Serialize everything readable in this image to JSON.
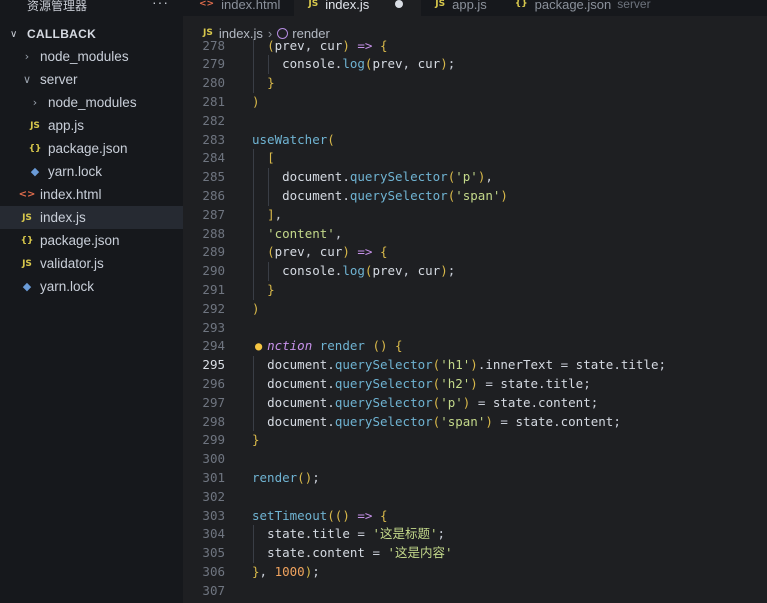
{
  "sidebar": {
    "title": "资源管理器",
    "more": "···",
    "section": "CALLBACK",
    "items": [
      {
        "label": "node_modules",
        "icon": "chevron-right",
        "level": 1
      },
      {
        "label": "server",
        "icon": "chevron-down",
        "level": 1
      },
      {
        "label": "node_modules",
        "icon": "chevron-right",
        "level": 2
      },
      {
        "label": "app.js",
        "icon": "js",
        "level": 2
      },
      {
        "label": "package.json",
        "icon": "json",
        "level": 2
      },
      {
        "label": "yarn.lock",
        "icon": "yarn",
        "level": 2
      },
      {
        "label": "index.html",
        "icon": "html",
        "level": 1
      },
      {
        "label": "index.js",
        "icon": "js",
        "level": 1,
        "active": true
      },
      {
        "label": "package.json",
        "icon": "json",
        "level": 1
      },
      {
        "label": "validator.js",
        "icon": "js",
        "level": 1
      },
      {
        "label": "yarn.lock",
        "icon": "yarn",
        "level": 1
      }
    ]
  },
  "tabs": [
    {
      "label": "index.html",
      "icon": "html"
    },
    {
      "label": "index.js",
      "icon": "js",
      "active": true,
      "modified": true
    },
    {
      "label": "app.js",
      "icon": "js"
    },
    {
      "label": "package.json",
      "icon": "json",
      "sub": "server"
    }
  ],
  "breadcrumb": {
    "file": "index.js",
    "symbol": "render",
    "file_icon": "JS"
  },
  "icon_text": {
    "js": "JS",
    "json": "{}",
    "html": "<>"
  },
  "editor": {
    "current_line": 295,
    "lines": [
      {
        "n": 278,
        "text": "  (prev, cur) => {"
      },
      {
        "n": 279,
        "text": "    console.log(prev, cur);"
      },
      {
        "n": 280,
        "text": "  }"
      },
      {
        "n": 281,
        "text": ")"
      },
      {
        "n": 282,
        "text": ""
      },
      {
        "n": 283,
        "text": "useWatcher("
      },
      {
        "n": 284,
        "text": "  ["
      },
      {
        "n": 285,
        "text": "    document.querySelector('p'),"
      },
      {
        "n": 286,
        "text": "    document.querySelector('span')"
      },
      {
        "n": 287,
        "text": "  ],"
      },
      {
        "n": 288,
        "text": "  'content',"
      },
      {
        "n": 289,
        "text": "  (prev, cur) => {"
      },
      {
        "n": 290,
        "text": "    console.log(prev, cur);"
      },
      {
        "n": 291,
        "text": "  }"
      },
      {
        "n": 292,
        "text": ")"
      },
      {
        "n": 293,
        "text": ""
      },
      {
        "n": 294,
        "text": "  nction render () {"
      },
      {
        "n": 295,
        "text": "  document.querySelector('h1').innerText = state.title;"
      },
      {
        "n": 296,
        "text": "  document.querySelector('h2') = state.title;"
      },
      {
        "n": 297,
        "text": "  document.querySelector('p') = state.content;"
      },
      {
        "n": 298,
        "text": "  document.querySelector('span') = state.content;"
      },
      {
        "n": 299,
        "text": "}"
      },
      {
        "n": 300,
        "text": ""
      },
      {
        "n": 301,
        "text": "render();"
      },
      {
        "n": 302,
        "text": ""
      },
      {
        "n": 303,
        "text": "setTimeout(() => {"
      },
      {
        "n": 304,
        "text": "  state.title = '这是标题';"
      },
      {
        "n": 305,
        "text": "  state.content = '这是内容'"
      },
      {
        "n": 306,
        "text": "}, 1000);"
      },
      {
        "n": 307,
        "text": ""
      }
    ]
  },
  "colors": {
    "background": "#1e1f22",
    "sidebar": "#16181c",
    "keyword": "#c792ea",
    "function": "#6fb3d2",
    "string": "#c3d88a",
    "number": "#f0a35e"
  }
}
